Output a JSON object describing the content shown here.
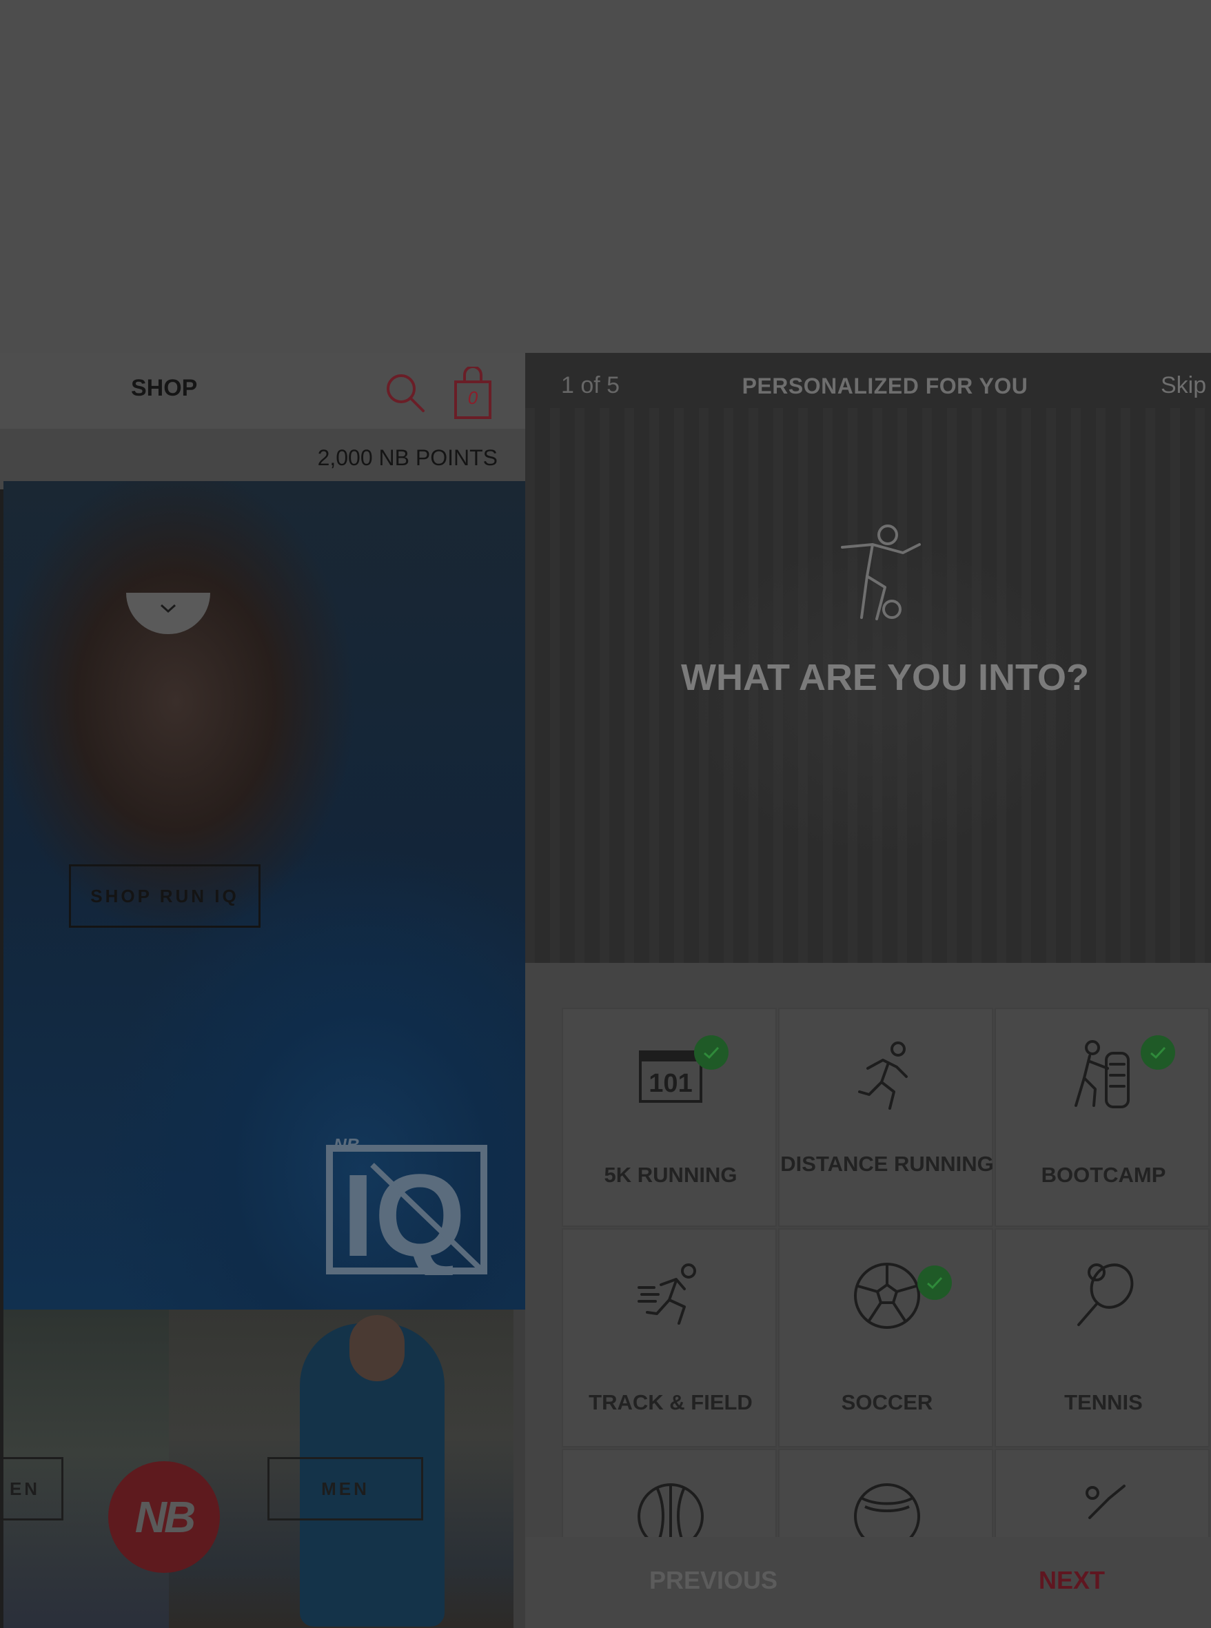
{
  "shop": {
    "title": "SHOP",
    "bag_count": "0",
    "points": "2,000 NB POINTS",
    "hero_cta": "SHOP RUN IQ",
    "women_cta": "EN",
    "men_cta": "MEN",
    "logo_text": "NB",
    "iq_logo_text": "IQ"
  },
  "personalize": {
    "step": "1 of 5",
    "title": "PERSONALIZED FOR YOU",
    "skip": "Skip",
    "question": "WHAT ARE YOU INTO?",
    "activities": [
      {
        "label": "5K RUNNING",
        "icon": "calendar-101-icon",
        "selected": true
      },
      {
        "label": "DISTANCE RUNNING",
        "icon": "runner-icon",
        "selected": false
      },
      {
        "label": "BOOTCAMP",
        "icon": "tire-flip-icon",
        "selected": true
      },
      {
        "label": "TRACK & FIELD",
        "icon": "sprinter-icon",
        "selected": false
      },
      {
        "label": "SOCCER",
        "icon": "soccer-ball-icon",
        "selected": true
      },
      {
        "label": "TENNIS",
        "icon": "tennis-racket-icon",
        "selected": false
      },
      {
        "label": "",
        "icon": "basketball-icon",
        "selected": false
      },
      {
        "label": "",
        "icon": "baseball-icon",
        "selected": false
      },
      {
        "label": "",
        "icon": "lacrosse-icon",
        "selected": false
      }
    ],
    "previous": "PREVIOUS",
    "next": "NEXT"
  },
  "colors": {
    "background": "#4d4d4d",
    "accent_red": "#5f1620",
    "check_green": "#1f5a27"
  }
}
